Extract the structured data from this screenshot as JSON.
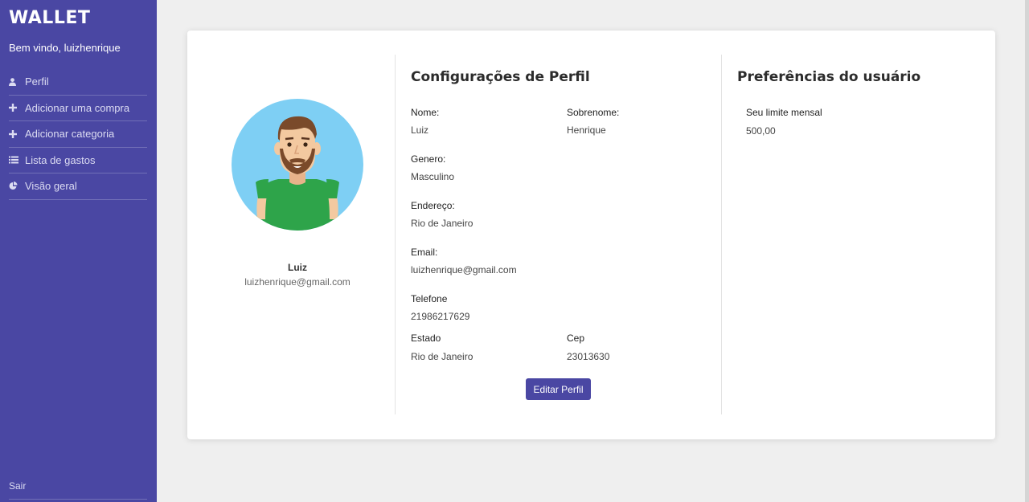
{
  "sidebar": {
    "brand": "WALLET",
    "welcome": "Bem vindo, luizhenrique",
    "items": [
      {
        "label": "Perfil",
        "icon": "user-icon"
      },
      {
        "label": "Adicionar uma compra",
        "icon": "plus-icon"
      },
      {
        "label": "Adicionar categoria",
        "icon": "plus-icon"
      },
      {
        "label": "Lista de gastos",
        "icon": "list-icon"
      },
      {
        "label": "Visão geral",
        "icon": "pie-chart-icon"
      }
    ],
    "logout": "Sair"
  },
  "profile": {
    "name": "Luiz",
    "email": "luizhenrique@gmail.com"
  },
  "settings": {
    "title": "Configurações de Perfil",
    "fields": {
      "nome": {
        "label": "Nome:",
        "value": "Luiz"
      },
      "sobrenome": {
        "label": "Sobrenome:",
        "value": "Henrique"
      },
      "genero": {
        "label": "Genero:",
        "value": "Masculino"
      },
      "endereco": {
        "label": "Endereço:",
        "value": "Rio de Janeiro"
      },
      "email": {
        "label": "Email:",
        "value": "luizhenrique@gmail.com"
      },
      "telefone": {
        "label": "Telefone",
        "value": "21986217629"
      },
      "estado": {
        "label": "Estado",
        "value": "Rio de Janeiro"
      },
      "cep": {
        "label": "Cep",
        "value": "23013630"
      }
    },
    "edit_button": "Editar Perfil"
  },
  "preferences": {
    "title": "Preferências do usuário",
    "limit_label": "Seu limite mensal",
    "limit_value": "500,00"
  },
  "colors": {
    "sidebar": "#4a47a3",
    "background": "#efefef",
    "button": "#4a47a3"
  }
}
